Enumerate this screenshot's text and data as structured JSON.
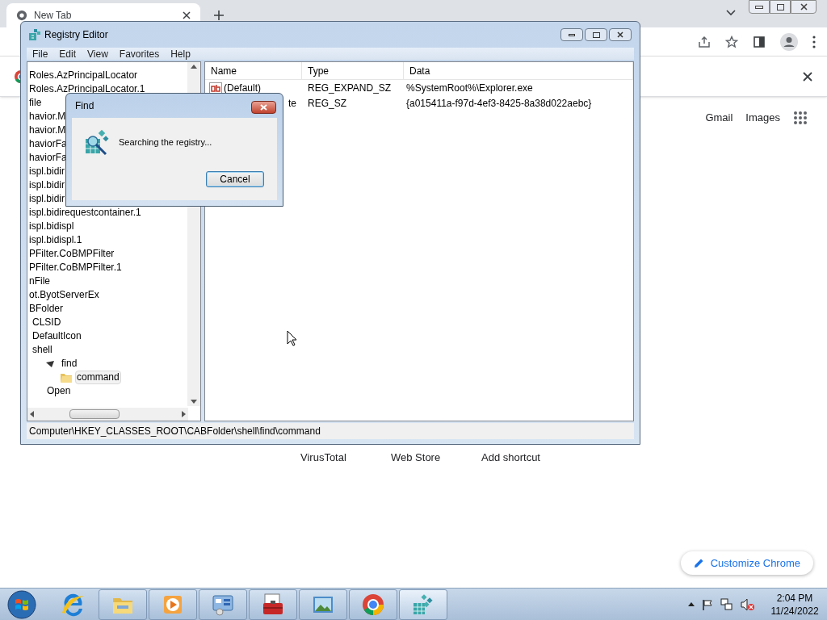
{
  "browser": {
    "tab_title": "New Tab",
    "links": [
      "Gmail",
      "Images"
    ],
    "shortcuts": [
      "VirusTotal",
      "Web Store",
      "Add shortcut"
    ],
    "customize_button": "Customize Chrome"
  },
  "registry_editor": {
    "title": "Registry Editor",
    "menu": [
      "File",
      "Edit",
      "View",
      "Favorites",
      "Help"
    ],
    "tree": [
      {
        "label": "Roles.AzPrincipalLocator",
        "selected": false
      },
      {
        "label": "Roles.AzPrincipalLocator.1",
        "selected": false
      },
      {
        "label": "file",
        "selected": false
      },
      {
        "label": "havior.M",
        "selected": false
      },
      {
        "label": "havior.M",
        "selected": false
      },
      {
        "label": "haviorFa",
        "selected": false
      },
      {
        "label": "haviorFa",
        "selected": false
      },
      {
        "label": "ispl.bidir",
        "selected": false
      },
      {
        "label": "ispl.bidir",
        "selected": false
      },
      {
        "label": "ispl.bidir",
        "selected": false
      },
      {
        "label": "ispl.bidirequestcontainer.1",
        "selected": false
      },
      {
        "label": "ispl.bidispl",
        "selected": false
      },
      {
        "label": "ispl.bidispl.1",
        "selected": false
      },
      {
        "label": "PFilter.CoBMPFilter",
        "selected": false
      },
      {
        "label": "PFilter.CoBMPFilter.1",
        "selected": false
      },
      {
        "label": "nFile",
        "selected": false
      },
      {
        "label": "ot.ByotServerEx",
        "selected": false
      },
      {
        "label": "BFolder",
        "selected": false,
        "children": [
          {
            "label": "CLSID",
            "selected": false
          },
          {
            "label": "DefaultIcon",
            "selected": false
          },
          {
            "label": "shell",
            "selected": false,
            "children": [
              {
                "label": "find",
                "selected": false,
                "children": [
                  {
                    "label": "command",
                    "selected": true
                  }
                ]
              },
              {
                "label": "Open",
                "selected": false
              }
            ]
          }
        ]
      }
    ],
    "columns": [
      "Name",
      "Type",
      "Data"
    ],
    "rows": [
      {
        "name": "(Default)",
        "type": "REG_EXPAND_SZ",
        "data": "%SystemRoot%\\Explorer.exe"
      },
      {
        "name": "te",
        "type": "REG_SZ",
        "data": "{a015411a-f97d-4ef3-8425-8a38d022aebc}"
      }
    ],
    "status_bar": "Computer\\HKEY_CLASSES_ROOT\\CABFolder\\shell\\find\\command"
  },
  "find_dialog": {
    "title": "Find",
    "message": "Searching the registry...",
    "button": "Cancel"
  },
  "taskbar": {
    "apps": [
      {
        "kind": "ie",
        "running": false,
        "selected": false
      },
      {
        "kind": "explorer",
        "running": true,
        "selected": false
      },
      {
        "kind": "media",
        "running": true,
        "selected": false
      },
      {
        "kind": "control",
        "running": true,
        "selected": false
      },
      {
        "kind": "toolbox",
        "running": true,
        "selected": false
      },
      {
        "kind": "photo",
        "running": true,
        "selected": false
      },
      {
        "kind": "chrome",
        "running": true,
        "selected": false
      },
      {
        "kind": "regedit",
        "running": true,
        "selected": true
      }
    ],
    "time": "2:04 PM",
    "date": "11/24/2022"
  }
}
